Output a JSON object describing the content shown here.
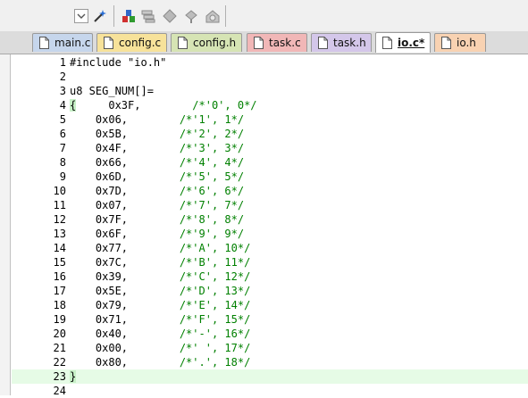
{
  "toolbar": {
    "buttons": [
      "dropdown-combo-icon",
      "wand-icon",
      "build-icon",
      "stack-icon",
      "diamond-icon",
      "flag-icon",
      "gear-chip-icon"
    ]
  },
  "tabs": [
    {
      "label": "main.c",
      "color": "#c6d6ec",
      "active": false
    },
    {
      "label": "config.c",
      "color": "#f7e29a",
      "active": false
    },
    {
      "label": "config.h",
      "color": "#d6e4b4",
      "active": false
    },
    {
      "label": "task.c",
      "color": "#f1b7b7",
      "active": false
    },
    {
      "label": "task.h",
      "color": "#d4c7ea",
      "active": false
    },
    {
      "label": "io.c*",
      "color": "#c9e4d8",
      "active": true
    },
    {
      "label": "io.h",
      "color": "#f8d2b2",
      "active": false
    }
  ],
  "editor": {
    "current_line": 23,
    "lines": [
      {
        "n": "1",
        "code": "#include \"io.h\""
      },
      {
        "n": "2",
        "code": ""
      },
      {
        "n": "3",
        "code": "u8 SEG_NUM[]="
      },
      {
        "n": "4",
        "code": "{     0x3F,        /*'0', 0*/"
      },
      {
        "n": "5",
        "code": "    0x06,        /*'1', 1*/"
      },
      {
        "n": "6",
        "code": "    0x5B,        /*'2', 2*/"
      },
      {
        "n": "7",
        "code": "    0x4F,        /*'3', 3*/"
      },
      {
        "n": "8",
        "code": "    0x66,        /*'4', 4*/"
      },
      {
        "n": "9",
        "code": "    0x6D,        /*'5', 5*/"
      },
      {
        "n": "10",
        "code": "    0x7D,        /*'6', 6*/"
      },
      {
        "n": "11",
        "code": "    0x07,        /*'7', 7*/"
      },
      {
        "n": "12",
        "code": "    0x7F,        /*'8', 8*/"
      },
      {
        "n": "13",
        "code": "    0x6F,        /*'9', 9*/"
      },
      {
        "n": "14",
        "code": "    0x77,        /*'A', 10*/"
      },
      {
        "n": "15",
        "code": "    0x7C,        /*'B', 11*/"
      },
      {
        "n": "16",
        "code": "    0x39,        /*'C', 12*/"
      },
      {
        "n": "17",
        "code": "    0x5E,        /*'D', 13*/"
      },
      {
        "n": "18",
        "code": "    0x79,        /*'E', 14*/"
      },
      {
        "n": "19",
        "code": "    0x71,        /*'F', 15*/"
      },
      {
        "n": "20",
        "code": "    0x40,        /*'-', 16*/"
      },
      {
        "n": "21",
        "code": "    0x00,        /*' ', 17*/"
      },
      {
        "n": "22",
        "code": "    0x80,        /*'.', 18*/"
      },
      {
        "n": "23",
        "code": "}"
      },
      {
        "n": "24",
        "code": ""
      }
    ]
  },
  "colors": {
    "comment": "#008000",
    "current_line_bg": "#e6fbe6",
    "brace_highlight": "#c7f0c7"
  }
}
